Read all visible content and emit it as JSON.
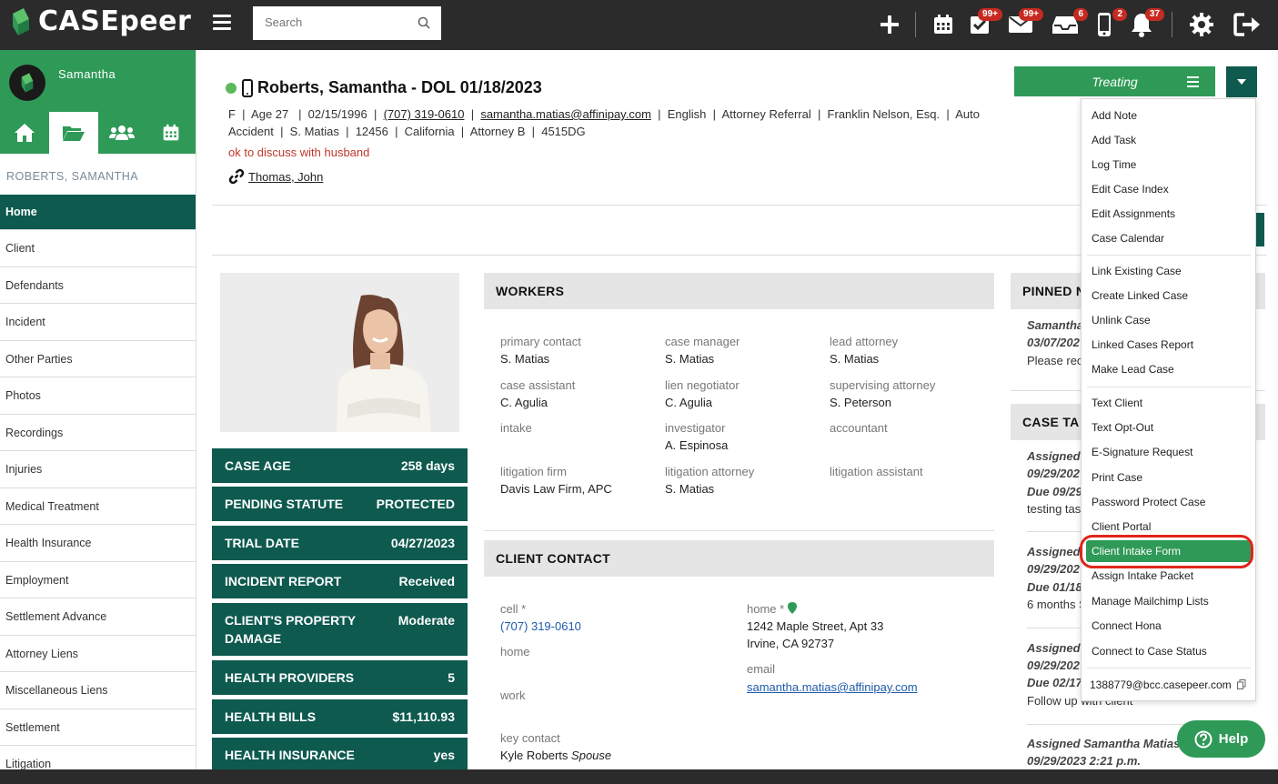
{
  "app": {
    "logo": "CASEpeer"
  },
  "search": {
    "placeholder": "Search"
  },
  "topbar": {
    "badges": {
      "tasks": "99+",
      "mail": "99+",
      "inbox": "6",
      "phone": "2",
      "bell": "37"
    }
  },
  "sidebar": {
    "user_name": "Samantha",
    "case_name": "ROBERTS, SAMANTHA",
    "items": [
      "Home",
      "Client",
      "Defendants",
      "Incident",
      "Other Parties",
      "Photos",
      "Recordings",
      "Injuries",
      "Medical Treatment",
      "Health Insurance",
      "Employment",
      "Settlement Advance",
      "Attorney Liens",
      "Miscellaneous Liens",
      "Settlement",
      "Litigation"
    ]
  },
  "case": {
    "title": "Roberts, Samantha - DOL 01/18/2023",
    "meta_line1_a": "F  |  Age 27   |  02/15/1996  |  ",
    "phone": "(707) 319-0610",
    "sep": "  |  ",
    "email": "samantha.matias@affinipay.com",
    "meta_line1_b": "  |  English  |  Attorney Referral  |  Franklin Nelson, Esq.  |  Auto",
    "meta_line2": "Accident  |  S. Matias  |  12456  |  California  |  Attorney B  |  4515DG",
    "note": "ok to discuss with husband",
    "linked_person": "Thomas, John"
  },
  "status": {
    "label": "Treating"
  },
  "menu": {
    "group1": [
      "Add Note",
      "Add Task",
      "Log Time",
      "Edit Case Index",
      "Edit Assignments",
      "Case Calendar"
    ],
    "group2": [
      "Link Existing Case",
      "Create Linked Case",
      "Unlink Case",
      "Linked Cases Report",
      "Make Lead Case"
    ],
    "group3": [
      "Text Client",
      "Text Opt-Out",
      "E-Signature Request",
      "Print Case",
      "Password Protect Case",
      "Client Portal",
      "Client Intake Form",
      "Assign Intake Packet",
      "Manage Mailchimp Lists",
      "Connect Hona",
      "Connect to Case Status"
    ],
    "email": "1388779@bcc.casepeer.com"
  },
  "stats": [
    {
      "label": "CASE AGE",
      "value": "258 days"
    },
    {
      "label": "PENDING STATUTE",
      "value": "PROTECTED"
    },
    {
      "label": "TRIAL DATE",
      "value": "04/27/2023"
    },
    {
      "label": "INCIDENT REPORT",
      "value": "Received"
    },
    {
      "label": "CLIENT'S PROPERTY",
      "label2": "DAMAGE",
      "value": "Moderate"
    },
    {
      "label": "HEALTH PROVIDERS",
      "value": "5"
    },
    {
      "label": "HEALTH BILLS",
      "value": "$11,110.93"
    },
    {
      "label": "HEALTH INSURANCE",
      "value": "yes"
    }
  ],
  "workers": {
    "title": "WORKERS",
    "items": [
      {
        "role": "primary contact",
        "name": "S. Matias"
      },
      {
        "role": "case manager",
        "name": "S. Matias"
      },
      {
        "role": "lead attorney",
        "name": "S. Matias"
      },
      {
        "role": "case assistant",
        "name": "C. Agulia"
      },
      {
        "role": "lien negotiator",
        "name": "C. Agulia"
      },
      {
        "role": "supervising attorney",
        "name": "S. Peterson"
      },
      {
        "role": "intake",
        "name": ""
      },
      {
        "role": "investigator",
        "name": "A. Espinosa"
      },
      {
        "role": "accountant",
        "name": ""
      },
      {
        "role": "litigation firm",
        "name": "Davis Law Firm, APC"
      },
      {
        "role": "litigation attorney",
        "name": "S. Matias"
      },
      {
        "role": "litigation assistant",
        "name": ""
      }
    ]
  },
  "contact": {
    "title": "CLIENT CONTACT",
    "cell_label": "cell *",
    "cell": "(707) 319-0610",
    "home_label": "home",
    "work_label": "work",
    "key_label": "key contact",
    "key_name": "Kyle Roberts",
    "key_rel": "Spouse",
    "home_addr_label": "home *",
    "addr1": "1242 Maple Street, Apt 33",
    "addr2": "Irvine, CA 92737",
    "email_label": "email",
    "email": "samantha.matias@affinipay.com"
  },
  "pinned": {
    "title": "PINNED N",
    "author": "Samantha",
    "date": "03/07/202",
    "text": "Please rec"
  },
  "tasks": {
    "title": "CASE TA",
    "entries": [
      {
        "assigned": "Assigned",
        "date": "09/29/202",
        "due": "Due 09/29",
        "text": "testing tas"
      },
      {
        "assigned": "Assigned",
        "date": "09/29/202",
        "due": "Due 01/18",
        "text": "6 months S"
      },
      {
        "assigned": "Assigned",
        "date": "09/29/202",
        "due": "Due 02/17",
        "text": "Follow up with client"
      }
    ],
    "last_assigned": "Assigned Samantha Matias",
    "last_date": "09/29/2023 2:21 p.m."
  },
  "help": {
    "label": "Help"
  },
  "colors": {
    "brand_green": "#2f9a57",
    "dark_teal": "#0e5a4f",
    "topbar": "#2b2b2b",
    "badge_red": "#c62a21",
    "highlight_ring": "#e0251a"
  }
}
